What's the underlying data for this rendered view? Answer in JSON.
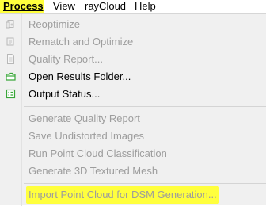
{
  "menubar": {
    "items": [
      {
        "label": "Process"
      },
      {
        "label": "View"
      },
      {
        "label": "rayCloud"
      },
      {
        "label": "Help"
      }
    ]
  },
  "process_menu": {
    "items": [
      {
        "label": "Reoptimize",
        "enabled": false,
        "icon": "reoptimize-icon"
      },
      {
        "label": "Rematch and Optimize",
        "enabled": false,
        "icon": "rematch-icon"
      },
      {
        "label": "Quality Report...",
        "enabled": false,
        "icon": "document-icon"
      },
      {
        "label": "Open Results Folder...",
        "enabled": true,
        "icon": "folder-icon"
      },
      {
        "label": "Output Status...",
        "enabled": true,
        "icon": "output-status-icon"
      },
      {
        "label": "Generate Quality Report",
        "enabled": false
      },
      {
        "label": "Save Undistorted Images",
        "enabled": false
      },
      {
        "label": "Run Point Cloud Classification",
        "enabled": false
      },
      {
        "label": "Generate 3D Textured Mesh",
        "enabled": false
      },
      {
        "label": "Import Point Cloud for DSM Generation...",
        "enabled": false
      }
    ]
  },
  "colors": {
    "highlight": "#ffff3d",
    "disabled_text": "#9d9d9d",
    "menu_bg": "#f0f0f0",
    "folder_icon": "#39a639"
  }
}
